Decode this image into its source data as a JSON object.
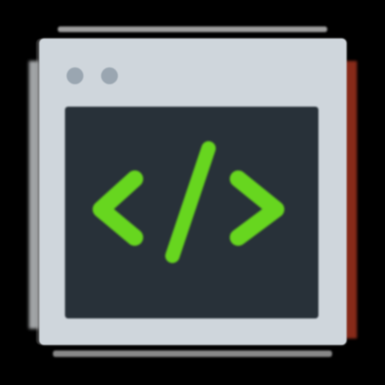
{
  "colors": {
    "background": "#000000",
    "window": "#cfd6dc",
    "window_controls": "#9aa6b1",
    "screen": "#283139",
    "code_symbol": "#67d61f",
    "right_shadow": "#8f2d1b",
    "edge_lines": "#b8b8b8"
  },
  "icons": {
    "window": "browser-window-icon",
    "code": "code-brackets-icon"
  }
}
